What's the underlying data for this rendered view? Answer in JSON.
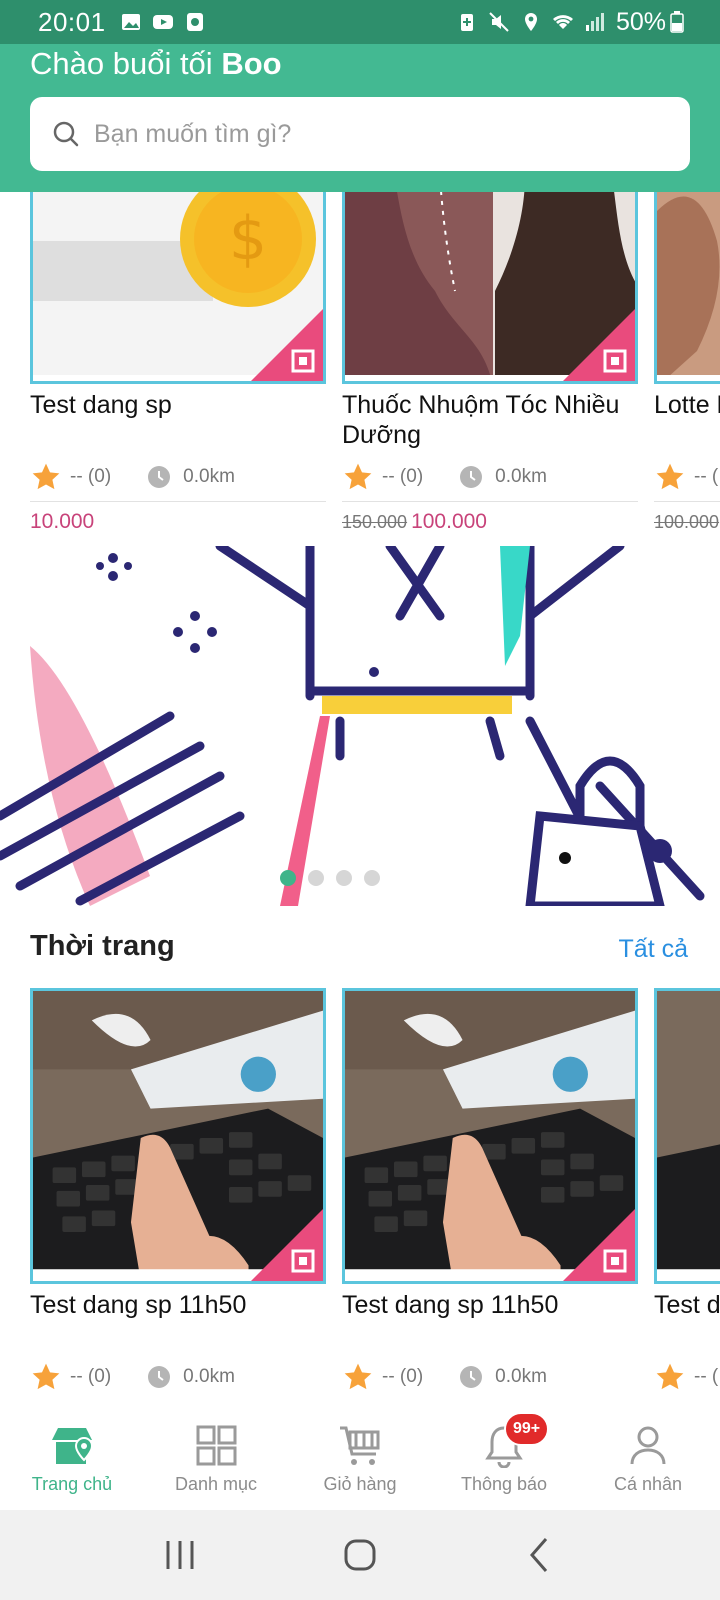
{
  "status_bar": {
    "time": "20:01",
    "battery": "50%"
  },
  "header": {
    "greeting_prefix": "Chào buổi tối",
    "greeting_name": "Boo",
    "search_placeholder": "Bạn muốn tìm gì?"
  },
  "top_products": [
    {
      "name": "Test dang sp",
      "rating": "-- (0)",
      "distance": "0.0km",
      "old_price": "",
      "price": "10.000"
    },
    {
      "name": "Thuốc Nhuộm Tóc Nhiều Dưỡng",
      "rating": "-- (0)",
      "distance": "0.0km",
      "old_price": "150.000",
      "price": "100.000"
    },
    {
      "name": "Lotte Ngừa",
      "rating": "-- (",
      "distance": "",
      "old_price": "100.000",
      "price": ""
    }
  ],
  "banner": {
    "pages": 4,
    "active_page": 1
  },
  "section": {
    "title": "Thời trang",
    "see_all": "Tất cả"
  },
  "fashion_products": [
    {
      "name": "Test dang sp 11h50",
      "rating": "-- (0)",
      "distance": "0.0km"
    },
    {
      "name": "Test dang sp 11h50",
      "rating": "-- (0)",
      "distance": "0.0km"
    },
    {
      "name": "Test d",
      "rating": "-- (",
      "distance": ""
    }
  ],
  "bottom_nav": [
    {
      "label": "Trang chủ",
      "icon": "home-store-icon",
      "active": true
    },
    {
      "label": "Danh mục",
      "icon": "grid-icon",
      "active": false
    },
    {
      "label": "Giỏ hàng",
      "icon": "cart-icon",
      "active": false
    },
    {
      "label": "Thông báo",
      "icon": "bell-icon",
      "active": false,
      "badge": "99+"
    },
    {
      "label": "Cá nhân",
      "icon": "person-icon",
      "active": false
    }
  ],
  "colors": {
    "header": "#43b992",
    "statusbar": "#2e8f6c",
    "accent": "#3fb48a",
    "price": "#c8437a",
    "link": "#2a8fe0",
    "badge": "#e12a2a"
  }
}
